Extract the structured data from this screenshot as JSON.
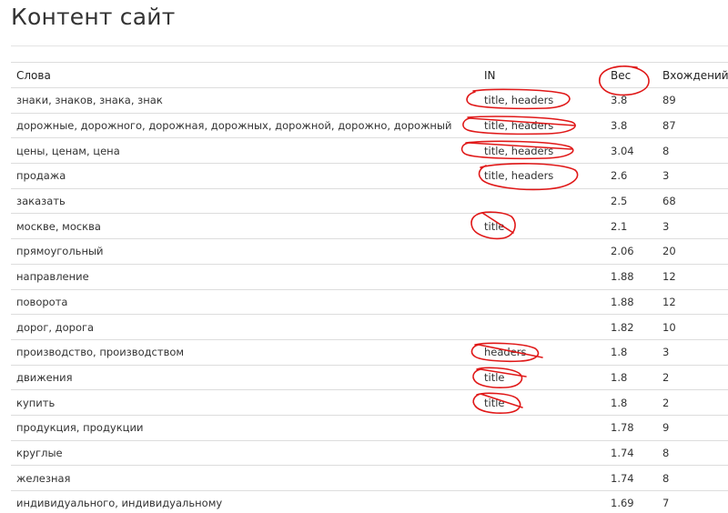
{
  "page": {
    "title": "Контент сайт"
  },
  "table": {
    "headers": {
      "words": "Слова",
      "in": "IN",
      "weight": "Вес",
      "count": "Вхождений"
    },
    "rows": [
      {
        "words": "знаки, знаков, знака, знак",
        "in": "title, headers",
        "weight": "3.8",
        "count": "89"
      },
      {
        "words": "дорожные, дорожного, дорожная, дорожных, дорожной, дорожно, дорожный",
        "in": "title, headers",
        "weight": "3.8",
        "count": "87"
      },
      {
        "words": "цены, ценам, цена",
        "in": "title, headers",
        "weight": "3.04",
        "count": "8"
      },
      {
        "words": "продажа",
        "in": "title, headers",
        "weight": "2.6",
        "count": "3"
      },
      {
        "words": "заказать",
        "in": "",
        "weight": "2.5",
        "count": "68"
      },
      {
        "words": "москве, москва",
        "in": "title",
        "weight": "2.1",
        "count": "3"
      },
      {
        "words": "прямоугольный",
        "in": "",
        "weight": "2.06",
        "count": "20"
      },
      {
        "words": "направление",
        "in": "",
        "weight": "1.88",
        "count": "12"
      },
      {
        "words": "поворота",
        "in": "",
        "weight": "1.88",
        "count": "12"
      },
      {
        "words": "дорог, дорога",
        "in": "",
        "weight": "1.82",
        "count": "10"
      },
      {
        "words": "производство, производством",
        "in": "headers",
        "weight": "1.8",
        "count": "3"
      },
      {
        "words": "движения",
        "in": "title",
        "weight": "1.8",
        "count": "2"
      },
      {
        "words": "купить",
        "in": "title",
        "weight": "1.8",
        "count": "2"
      },
      {
        "words": "продукция, продукции",
        "in": "",
        "weight": "1.78",
        "count": "9"
      },
      {
        "words": "круглые",
        "in": "",
        "weight": "1.74",
        "count": "8"
      },
      {
        "words": "железная",
        "in": "",
        "weight": "1.74",
        "count": "8"
      },
      {
        "words": "индивидуального, индивидуальному",
        "in": "",
        "weight": "1.69",
        "count": "7"
      }
    ]
  },
  "annotation": {
    "color": "#e01818"
  }
}
